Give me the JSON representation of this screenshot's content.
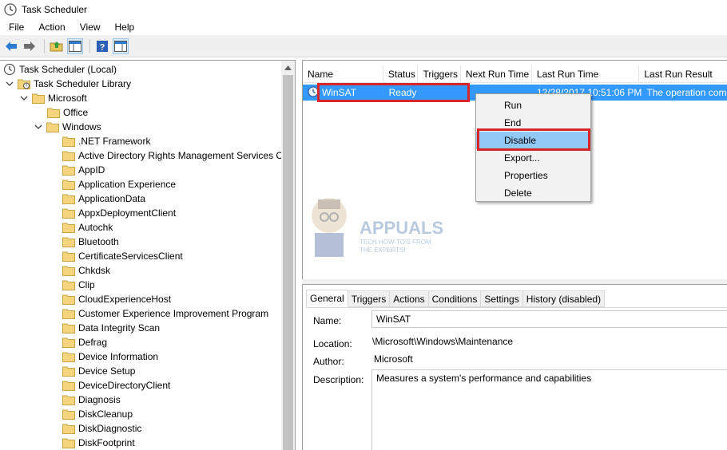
{
  "window": {
    "title": "Task Scheduler"
  },
  "menu": [
    "File",
    "Action",
    "View",
    "Help"
  ],
  "toolbar": {
    "back": "back-arrow-icon",
    "forward": "forward-arrow-icon",
    "up": "up-folder-icon",
    "show_hide": "console-tree-icon",
    "help": "help-icon",
    "action_pane": "action-pane-icon"
  },
  "tree": {
    "root": "Task Scheduler (Local)",
    "library": "Task Scheduler Library",
    "microsoft": "Microsoft",
    "office": "Office",
    "windows": "Windows",
    "windows_children": [
      ".NET Framework",
      "Active Directory Rights Management Services Client",
      "AppID",
      "Application Experience",
      "ApplicationData",
      "AppxDeploymentClient",
      "Autochk",
      "Bluetooth",
      "CertificateServicesClient",
      "Chkdsk",
      "Clip",
      "CloudExperienceHost",
      "Customer Experience Improvement Program",
      "Data Integrity Scan",
      "Defrag",
      "Device Information",
      "Device Setup",
      "DeviceDirectoryClient",
      "Diagnosis",
      "DiskCleanup",
      "DiskDiagnostic",
      "DiskFootprint"
    ]
  },
  "task_list": {
    "columns": [
      "Name",
      "Status",
      "Triggers",
      "Next Run Time",
      "Last Run Time",
      "Last Run Result"
    ],
    "rows": [
      {
        "name": "WinSAT",
        "status": "Ready",
        "triggers": "",
        "next_run": "",
        "last_run": "12/28/2017 10:51:06 PM",
        "result": "The operation completed successfully."
      }
    ]
  },
  "context_menu": [
    "Run",
    "End",
    "Disable",
    "Export...",
    "Properties",
    "Delete"
  ],
  "context_menu_highlighted": "Disable",
  "details": {
    "tabs": [
      "General",
      "Triggers",
      "Actions",
      "Conditions",
      "Settings",
      "History (disabled)"
    ],
    "active_tab": "General",
    "name_label": "Name:",
    "name_value": "WinSAT",
    "location_label": "Location:",
    "location_value": "\\Microsoft\\Windows\\Maintenance",
    "author_label": "Author:",
    "author_value": "Microsoft",
    "description_label": "Description:",
    "description_value": "Measures a system's performance and capabilities"
  },
  "watermark": {
    "line1": "APPUALS",
    "line2": "TECH HOW-TO'S FROM",
    "line3": "THE EXPERTS!"
  },
  "colors": {
    "selection": "#3399ff",
    "menu_highlight": "#91c9f7",
    "annotation_red": "#d9252a",
    "folder": "#f4d47c"
  }
}
